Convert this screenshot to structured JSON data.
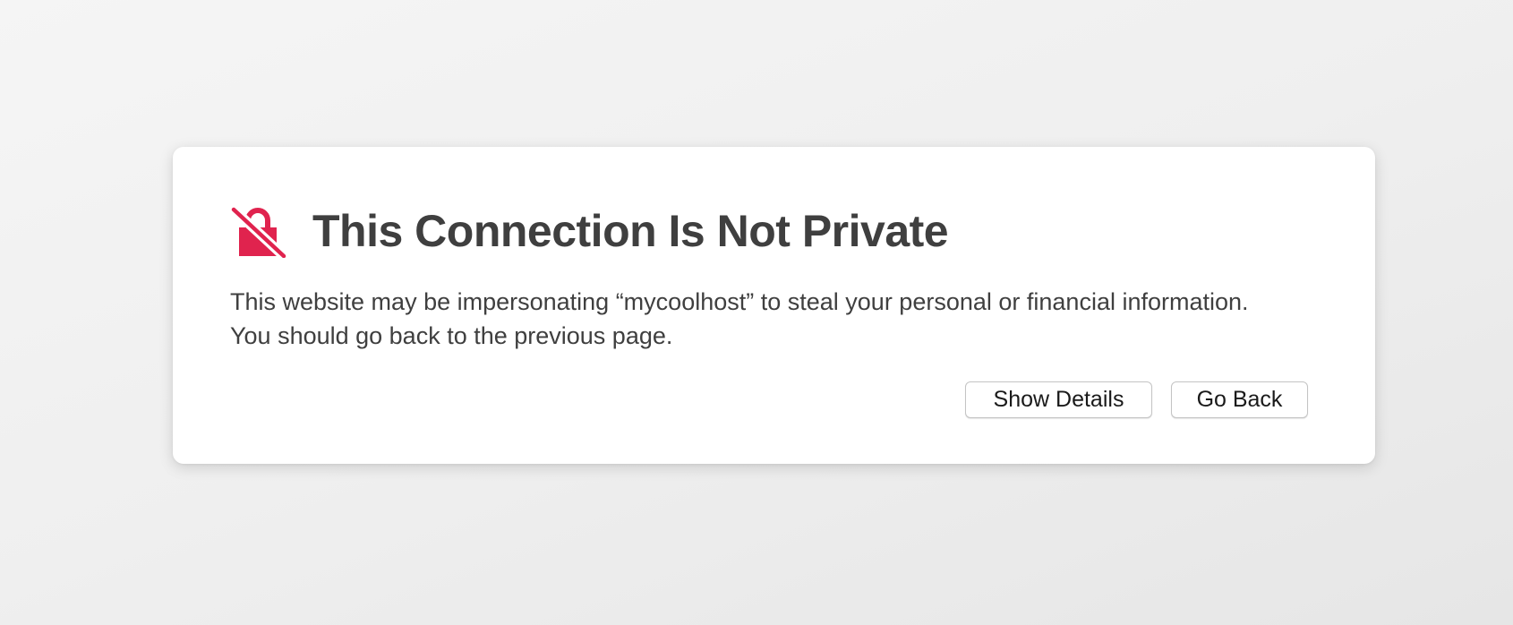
{
  "dialog": {
    "icon": "broken-lock-icon",
    "icon_color": "#e0234e",
    "title": "This Connection Is Not Private",
    "message": "This website may be impersonating “mycoolhost” to steal your personal or financial information. You should go back to the previous page.",
    "buttons": {
      "show_details": "Show Details",
      "go_back": "Go Back"
    }
  }
}
